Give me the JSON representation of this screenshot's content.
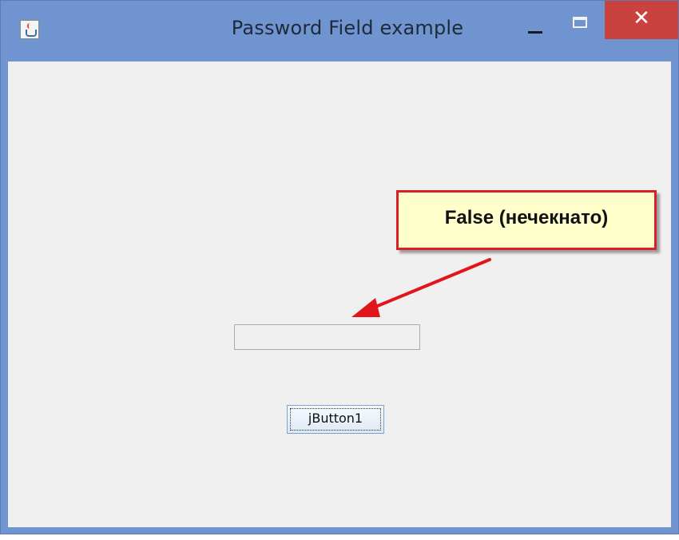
{
  "window": {
    "title": "Password Field example"
  },
  "titlebar": {
    "app_icon": "java-cup-icon",
    "minimize_icon": "minimize-icon",
    "maximize_icon": "maximize-icon",
    "close_label": "✕"
  },
  "form": {
    "password_value": "",
    "button_label": "jButton1"
  },
  "annotation": {
    "text": "False (нечекнато)",
    "border_color": "#d8202a",
    "fill_color": "#ffffcc",
    "arrow_color": "#e3151c"
  },
  "colors": {
    "titlebar": "#6f94cf",
    "close": "#c9423d",
    "content": "#f0f0f0"
  }
}
